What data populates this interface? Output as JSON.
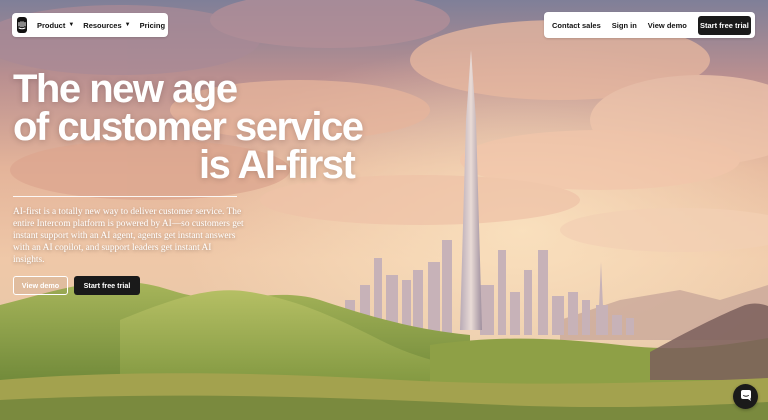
{
  "nav": {
    "product": "Product",
    "resources": "Resources",
    "pricing": "Pricing",
    "contact_sales": "Contact sales",
    "sign_in": "Sign in",
    "view_demo": "View demo",
    "start_trial": "Start free trial"
  },
  "hero": {
    "line1": "The new age",
    "line2": "of customer service",
    "line3": "is AI-first",
    "subtext": "AI-first is a totally new way to deliver customer service. The entire Intercom platform is powered by AI—so customers get instant support with an AI agent, agents get instant answers with an AI copilot, and support leaders get instant AI insights.",
    "view_demo": "View demo",
    "start_trial": "Start free trial"
  },
  "icons": {
    "logo": "intercom-logo-icon",
    "chat": "chat-bubble-icon",
    "caret": "chevron-down-icon"
  },
  "colors": {
    "button_dark": "#1a1a1a",
    "text_light": "#ffffff"
  }
}
